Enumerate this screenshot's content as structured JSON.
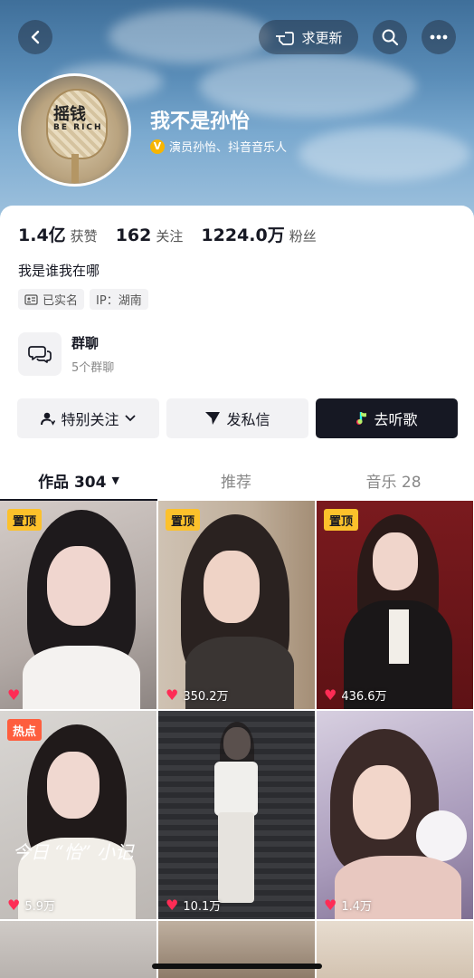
{
  "header": {
    "update_label": "求更新",
    "username": "我不是孙怡",
    "verify_text": "演员孙怡、抖音音乐人",
    "avatar_text_1": "摇钱",
    "avatar_text_2": "BE RICH"
  },
  "stats": [
    {
      "value": "1.4亿",
      "label": "获赞"
    },
    {
      "value": "162",
      "label": "关注"
    },
    {
      "value": "1224.0万",
      "label": "粉丝"
    }
  ],
  "bio": "我是谁我在哪",
  "tags": {
    "realname": "已实名",
    "ip": "IP：湖南"
  },
  "group": {
    "title": "群聊",
    "subtitle": "5个群聊"
  },
  "actions": {
    "follow": "特别关注",
    "message": "发私信",
    "music": "去听歌"
  },
  "tabs": {
    "works": "作品 304",
    "recommend": "推荐",
    "music": "音乐 28"
  },
  "videos": [
    {
      "badge": "置顶",
      "likes": ""
    },
    {
      "badge": "置顶",
      "likes": "350.2万"
    },
    {
      "badge": "置顶",
      "likes": "436.6万"
    },
    {
      "badge": "热点",
      "likes": "5.9万",
      "overlay": "今日 “怡” 小记"
    },
    {
      "badge": "",
      "likes": "10.1万"
    },
    {
      "badge": "",
      "likes": "1.4万"
    }
  ],
  "colors": {
    "accent": "#fe2c55",
    "pin_badge": "#fcc12b",
    "hot_badge": "#fe5e3e",
    "dark_button": "#161823"
  }
}
